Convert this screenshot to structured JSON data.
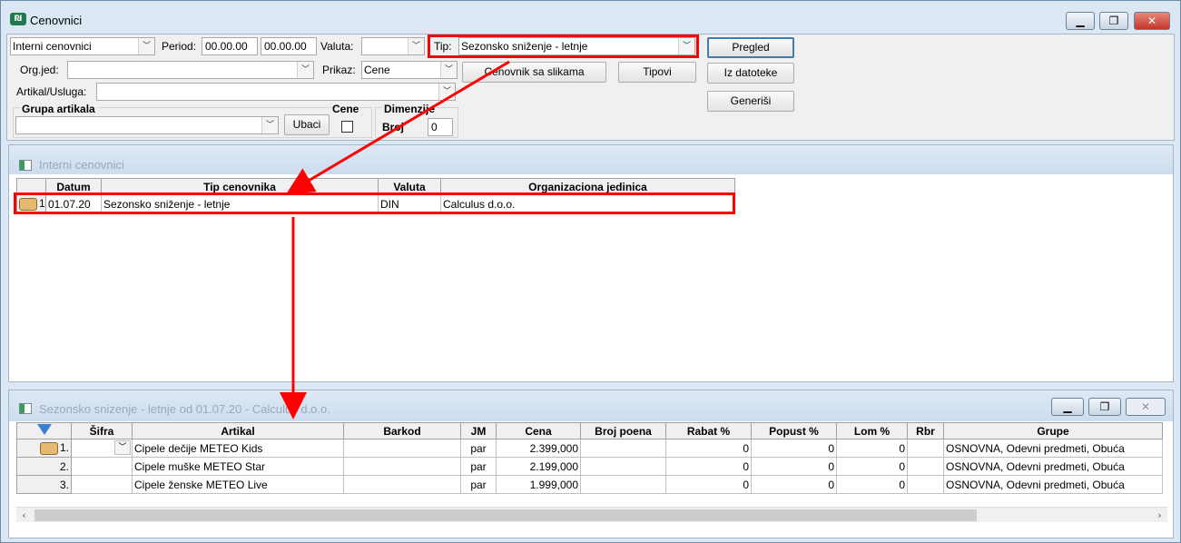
{
  "window": {
    "title": "Cenovnici",
    "minimize": "▁",
    "maximize": "❐",
    "close": "✕"
  },
  "form": {
    "type_combo": "Interni cenovnici",
    "period_label": "Period:",
    "period_from": "00.00.00",
    "period_to": "00.00.00",
    "valuta_label": "Valuta:",
    "valuta_value": "",
    "tip_label": "Tip:",
    "tip_value": "Sezonsko sniženje - letnje",
    "org_label": "Org.jed:",
    "org_value": "",
    "prikaz_label": "Prikaz:",
    "prikaz_value": "Cene",
    "artikal_label": "Artikal/Usluga:",
    "artikal_value": "",
    "grupa_label": "Grupa artikala",
    "grupa_value": "",
    "ubaci_label": "Ubaci",
    "cene_label": "Cene",
    "cene_checked": false,
    "dimenzije_label": "Dimenzije",
    "broj_label": "Broj",
    "broj_value": "0",
    "cenovnik_slike_label": "Cenovnik sa slikama",
    "tipovi_label": "Tipovi",
    "pregled_label": "Pregled",
    "iz_datoteke_label": "Iz datoteke",
    "generisi_label": "Generiši"
  },
  "top_panel": {
    "title": "Interni cenovnici",
    "columns": [
      "Datum",
      "Tip cenovnika",
      "Valuta",
      "Organizaciona jedinica"
    ],
    "rows": [
      {
        "rownum": "1.",
        "datum": "01.07.20",
        "tip": "Sezonsko sniženje - letnje",
        "valuta": "DIN",
        "org": "Calculus d.o.o."
      }
    ]
  },
  "bottom_panel": {
    "title": "Sezonsko snizenje - letnje od 01.07.20 - Calculus d.o.o.",
    "columns": [
      "Šifra",
      "Artikal",
      "Barkod",
      "JM",
      "Cena",
      "Broj poena",
      "Rabat %",
      "Popust %",
      "Lom %",
      "Rbr",
      "Grupe"
    ],
    "rows": [
      {
        "rownum": "1.",
        "sifra": "",
        "artikal": "Cipele dečije METEO Kids",
        "barkod": "",
        "jm": "par",
        "cena": "2.399,000",
        "poena": "",
        "rabat": "0",
        "popust": "0",
        "lom": "0",
        "rbr": "",
        "grupe": "OSNOVNA, Odevni predmeti, Obuća"
      },
      {
        "rownum": "2.",
        "sifra": "",
        "artikal": "Cipele muške METEO Star",
        "barkod": "",
        "jm": "par",
        "cena": "2.199,000",
        "poena": "",
        "rabat": "0",
        "popust": "0",
        "lom": "0",
        "rbr": "",
        "grupe": "OSNOVNA, Odevni predmeti, Obuća"
      },
      {
        "rownum": "3.",
        "sifra": "",
        "artikal": "Cipele ženske METEO Live",
        "barkod": "",
        "jm": "par",
        "cena": "1.999,000",
        "poena": "",
        "rabat": "0",
        "popust": "0",
        "lom": "0",
        "rbr": "",
        "grupe": "OSNOVNA, Odevni predmeti, Obuća"
      }
    ]
  },
  "colors": {
    "annotation": "#ff0000",
    "titlebar": "#dbe8f3",
    "default_button_border": "#3c7fb1"
  }
}
